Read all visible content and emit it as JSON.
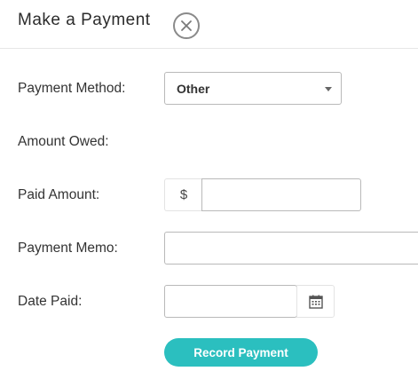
{
  "dialog": {
    "title": "Make a Payment",
    "close_icon": "close-circle-icon"
  },
  "form": {
    "payment_method": {
      "label": "Payment Method:",
      "value": "Other",
      "icon": "caret-down-icon"
    },
    "amount_owed": {
      "label": "Amount Owed:",
      "value": ""
    },
    "paid_amount": {
      "label": "Paid Amount:",
      "prefix": "$",
      "value": "",
      "placeholder": ""
    },
    "payment_memo": {
      "label": "Payment Memo:",
      "value": "",
      "placeholder": ""
    },
    "date_paid": {
      "label": "Date Paid:",
      "value": "",
      "placeholder": "",
      "icon": "calendar-icon"
    }
  },
  "actions": {
    "submit_label": "Record Payment",
    "accent_color": "#2bbfbf"
  }
}
